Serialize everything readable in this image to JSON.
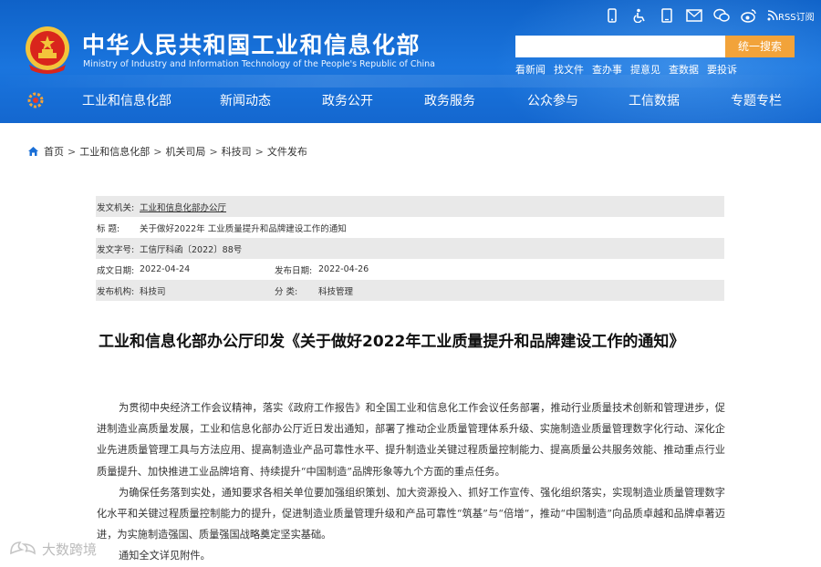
{
  "header": {
    "title": "中华人民共和国工业和信息化部",
    "subtitle": "Ministry of Industry and Information Technology of the People's Republic of China",
    "util_icons": [
      "mobile-icon",
      "accessibility-icon",
      "tablet-icon",
      "mail-icon",
      "weixin-icon",
      "weibo-icon",
      "rss-icon"
    ],
    "rss_label": "RSS订阅",
    "search": {
      "placeholder": "",
      "button_label": "统一搜索"
    },
    "quick_links": [
      "看新闻",
      "找文件",
      "查办事",
      "提意见",
      "查数据",
      "要投诉"
    ],
    "nav": [
      "工业和信息化部",
      "新闻动态",
      "政务公开",
      "政务服务",
      "公众参与",
      "工信数据",
      "专题专栏"
    ],
    "colors": {
      "header_bg": "#1a75de",
      "search_button": "#f2a33a"
    }
  },
  "breadcrumb": [
    "首页",
    "工业和信息化部",
    "机关司局",
    "科技司",
    "文件发布"
  ],
  "meta": {
    "issuer_label": "发文机关:",
    "issuer": "工业和信息化部办公厅",
    "title_label": "标 题:",
    "title": "关于做好2022年 工业质量提升和品牌建设工作的通知",
    "doc_no_label": "发文字号:",
    "doc_no": "工信厅科函〔2022〕88号",
    "created_label": "成文日期:",
    "created": "2022-04-24",
    "published_label": "发布日期:",
    "published": "2022-04-26",
    "org_label": "发布机构:",
    "org": "科技司",
    "category_label": "分 类:",
    "category": "科技管理"
  },
  "article": {
    "title": "工业和信息化部办公厅印发《关于做好2022年工业质量提升和品牌建设工作的通知》",
    "paragraphs": [
      "为贯彻中央经济工作会议精神，落实《政府工作报告》和全国工业和信息化工作会议任务部署，推动行业质量技术创新和管理进步，促进制造业高质量发展，工业和信息化部办公厅近日发出通知，部署了推动企业质量管理体系升级、实施制造业质量管理数字化行动、深化企业先进质量管理工具与方法应用、提高制造业产品可靠性水平、提升制造业关键过程质量控制能力、提高质量公共服务效能、推动重点行业质量提升、加快推进工业品牌培育、持续提升“中国制造”品牌形象等九个方面的重点任务。",
      "为确保任务落到实处，通知要求各相关单位要加强组织策划、加大资源投入、抓好工作宣传、强化组织落实，实现制造业质量管理数字化水平和关键过程质量控制能力的提升，促进制造业质量管理升级和产品可靠性“筑基”与“倍增”，推动“中国制造”向品质卓越和品牌卓著迈进，为实施制造强国、质量强国战略奠定坚实基础。",
      "通知全文详见附件。"
    ]
  },
  "watermark": "大数跨境"
}
